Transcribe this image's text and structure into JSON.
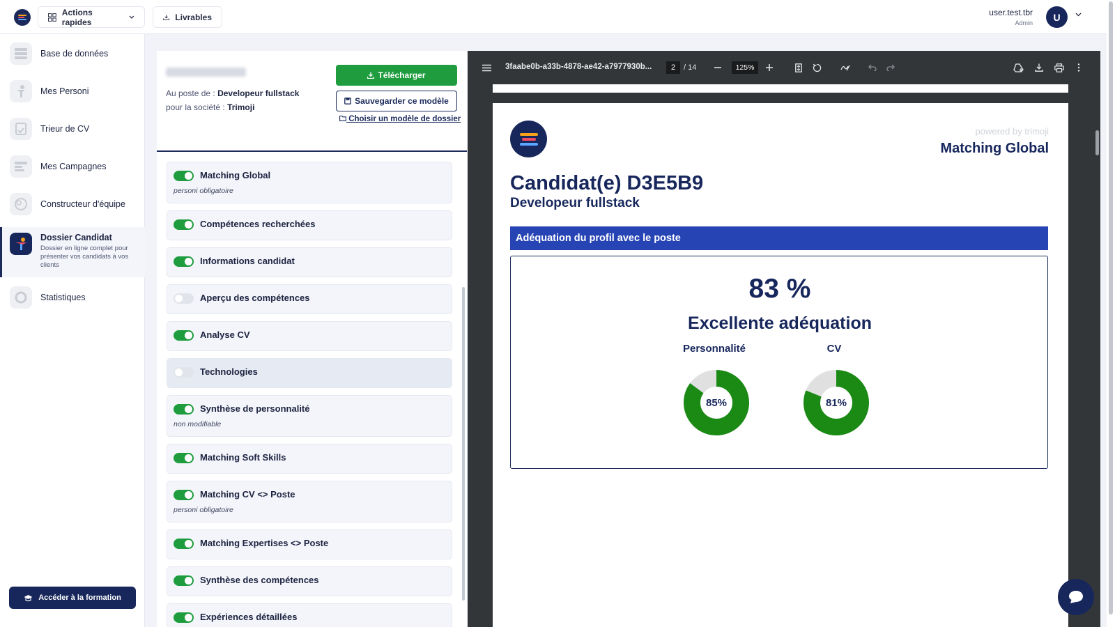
{
  "topbar": {
    "quick_actions": "Actions rapides",
    "deliverables": "Livrables",
    "user_name": "user.test.tbr",
    "user_role": "Admin",
    "avatar_letter": "U"
  },
  "sidebar": {
    "items": [
      {
        "label": "Base de données"
      },
      {
        "label": "Mes Personi"
      },
      {
        "label": "Trieur de CV"
      },
      {
        "label": "Mes Campagnes"
      },
      {
        "label": "Constructeur d'équipe"
      },
      {
        "label": "Dossier Candidat",
        "description": "Dossier en ligne complet pour présenter vos candidats à vos clients"
      },
      {
        "label": "Statistiques"
      }
    ],
    "formation_button": "Accéder à la formation"
  },
  "candidate": {
    "position_prefix": "Au poste de :",
    "position": "Developeur fullstack",
    "company_prefix": "pour la société :",
    "company": "Trimoji",
    "download_button": "Télécharger",
    "save_template_button": "Sauvegarder ce modèle",
    "choose_template_link": "Choisir un modèle de dossier"
  },
  "sections": [
    {
      "label": "Matching Global",
      "enabled": true,
      "note": "personi obligatoire"
    },
    {
      "label": "Compétences recherchées",
      "enabled": true
    },
    {
      "label": "Informations candidat",
      "enabled": true
    },
    {
      "label": "Aperçu des compétences",
      "enabled": false
    },
    {
      "label": "Analyse CV",
      "enabled": true
    },
    {
      "label": "Technologies",
      "enabled": false
    },
    {
      "label": "Synthèse de personnalité",
      "enabled": true,
      "note": "non modifiable"
    },
    {
      "label": "Matching Soft Skills",
      "enabled": true
    },
    {
      "label": "Matching CV <> Poste",
      "enabled": true,
      "note": "personi obligatoire"
    },
    {
      "label": "Matching Expertises <> Poste",
      "enabled": true
    },
    {
      "label": "Synthèse des compétences",
      "enabled": true
    },
    {
      "label": "Expériences détaillées",
      "enabled": true
    }
  ],
  "viewer": {
    "file_name": "3faabe0b-a33b-4878-ae42-a7977930b...",
    "current_page": "2",
    "page_count": "/ 14",
    "zoom": "125%"
  },
  "pdf_page": {
    "powered_by": "powered by trimoji",
    "header_title": "Matching Global",
    "candidate_title": "Candidat(e) D3E5B9",
    "role": "Developeur fullstack",
    "band_title": "Adéquation du profil avec le poste",
    "score": "83 %",
    "verdict": "Excellente adéquation",
    "categories": [
      {
        "label": "Personnalité",
        "value": 85,
        "display": "85%"
      },
      {
        "label": "CV",
        "value": 81,
        "display": "81%"
      }
    ],
    "colors": {
      "fill": "#1a8a14",
      "remainder": "#e0e0e0",
      "accent": "#2744b5",
      "navy": "#17275c"
    }
  }
}
